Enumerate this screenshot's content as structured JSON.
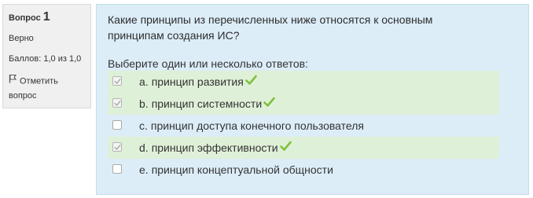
{
  "question_info": {
    "label": "Вопрос",
    "number": "1",
    "state": "Верно",
    "grade": "Баллов: 1,0 из 1,0",
    "flag_line1": "Отметить",
    "flag_line2": "вопрос",
    "flag_icon": "flag-icon"
  },
  "question": {
    "text_line1": "Какие принципы из перечисленных ниже относятся к основным",
    "text_line2": "принципам создания ИС?",
    "prompt": "Выберите один или несколько ответов:"
  },
  "answers": [
    {
      "letter": "a.",
      "text": "принцип развития",
      "checked": true,
      "correct": true
    },
    {
      "letter": "b.",
      "text": "принцип системности",
      "checked": true,
      "correct": true
    },
    {
      "letter": "c.",
      "text": "принцип доступа конечного пользователя",
      "checked": false,
      "correct": false
    },
    {
      "letter": "d.",
      "text": "принцип эффективности",
      "checked": true,
      "correct": true
    },
    {
      "letter": "e.",
      "text": "принцип концептуальной общности",
      "checked": false,
      "correct": false
    }
  ],
  "colors": {
    "info_bg": "#f0f0f0",
    "content_bg": "#dcedf8",
    "correct_bg": "#dff0d8",
    "tick": "#7fc13d"
  }
}
